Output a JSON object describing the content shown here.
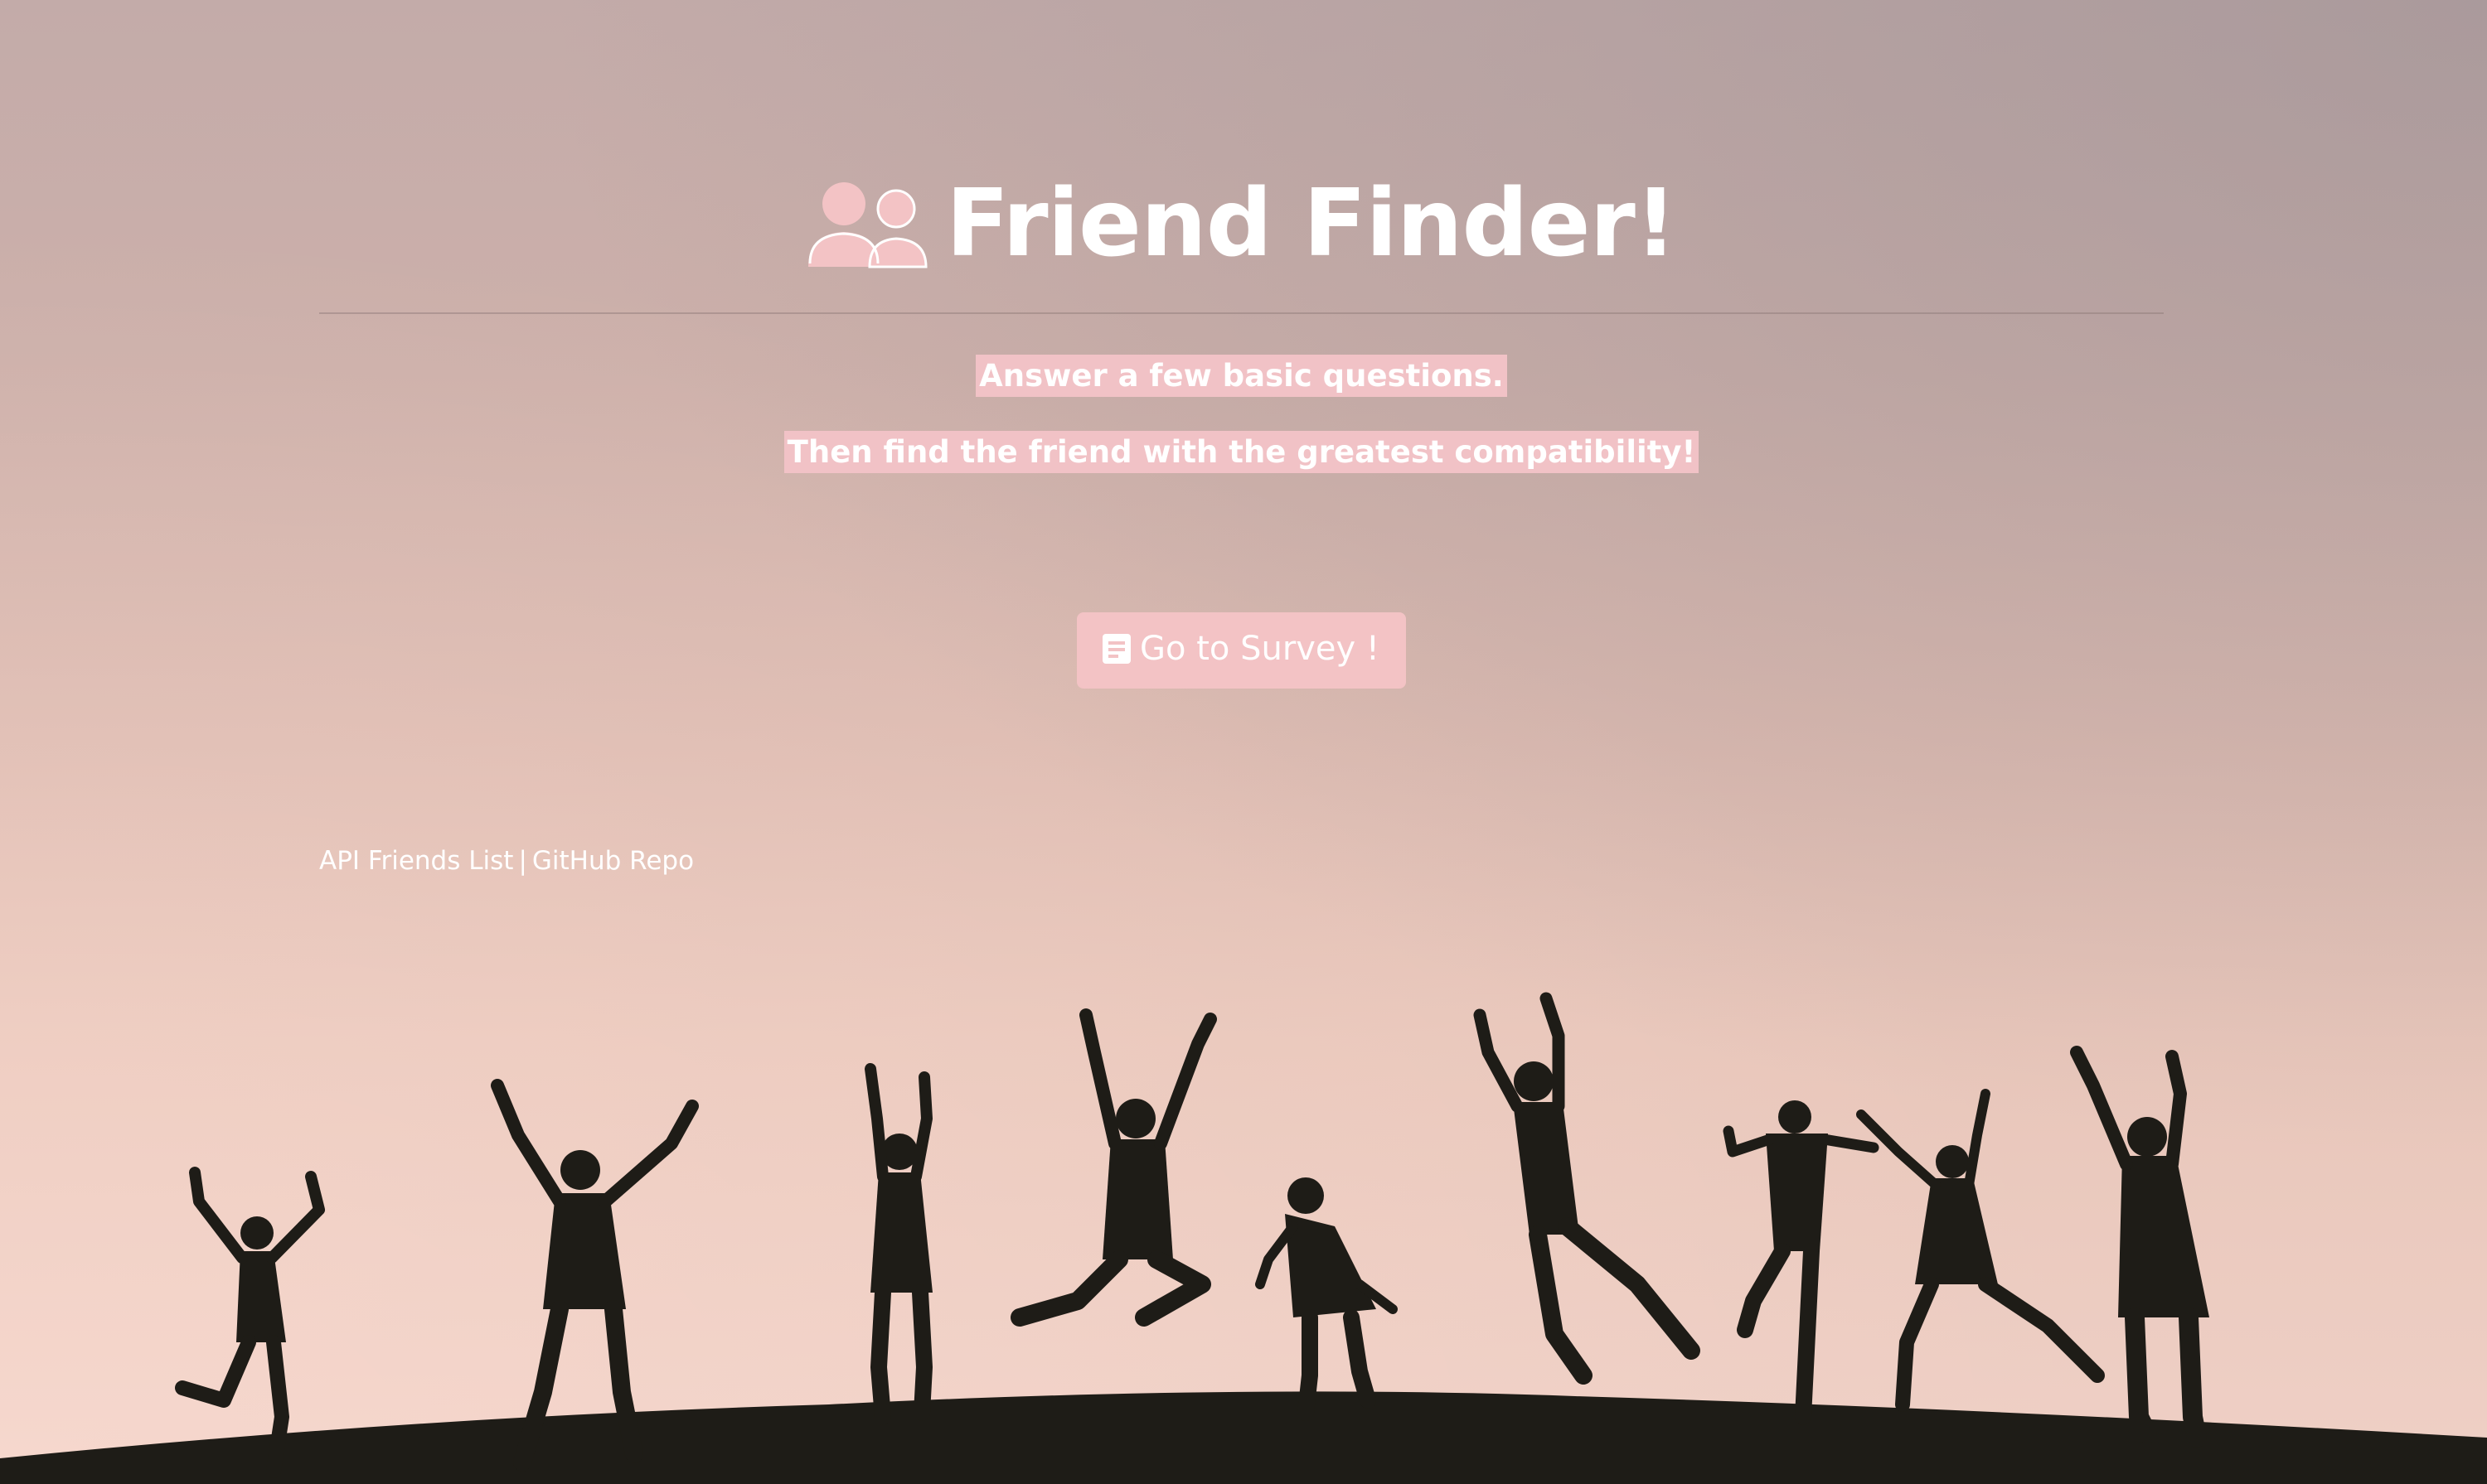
{
  "header": {
    "title": "Friend Finder!",
    "title_icon": "users-icon"
  },
  "intro": {
    "line1": "Answer a few basic questions.",
    "line2": "Then find the friend with the greatest compatibility!"
  },
  "survey_button": {
    "label": "Go to Survey !",
    "icon": "document-icon"
  },
  "footer": {
    "api_link": "API Friends List",
    "separator": "|",
    "github_link": "GitHub Repo"
  },
  "colors": {
    "accent_pink": "#f3c3c5",
    "text": "#ffffff",
    "silhouette": "#1e1c17"
  },
  "background": {
    "description_icon": "jumping-people-silhouettes"
  }
}
